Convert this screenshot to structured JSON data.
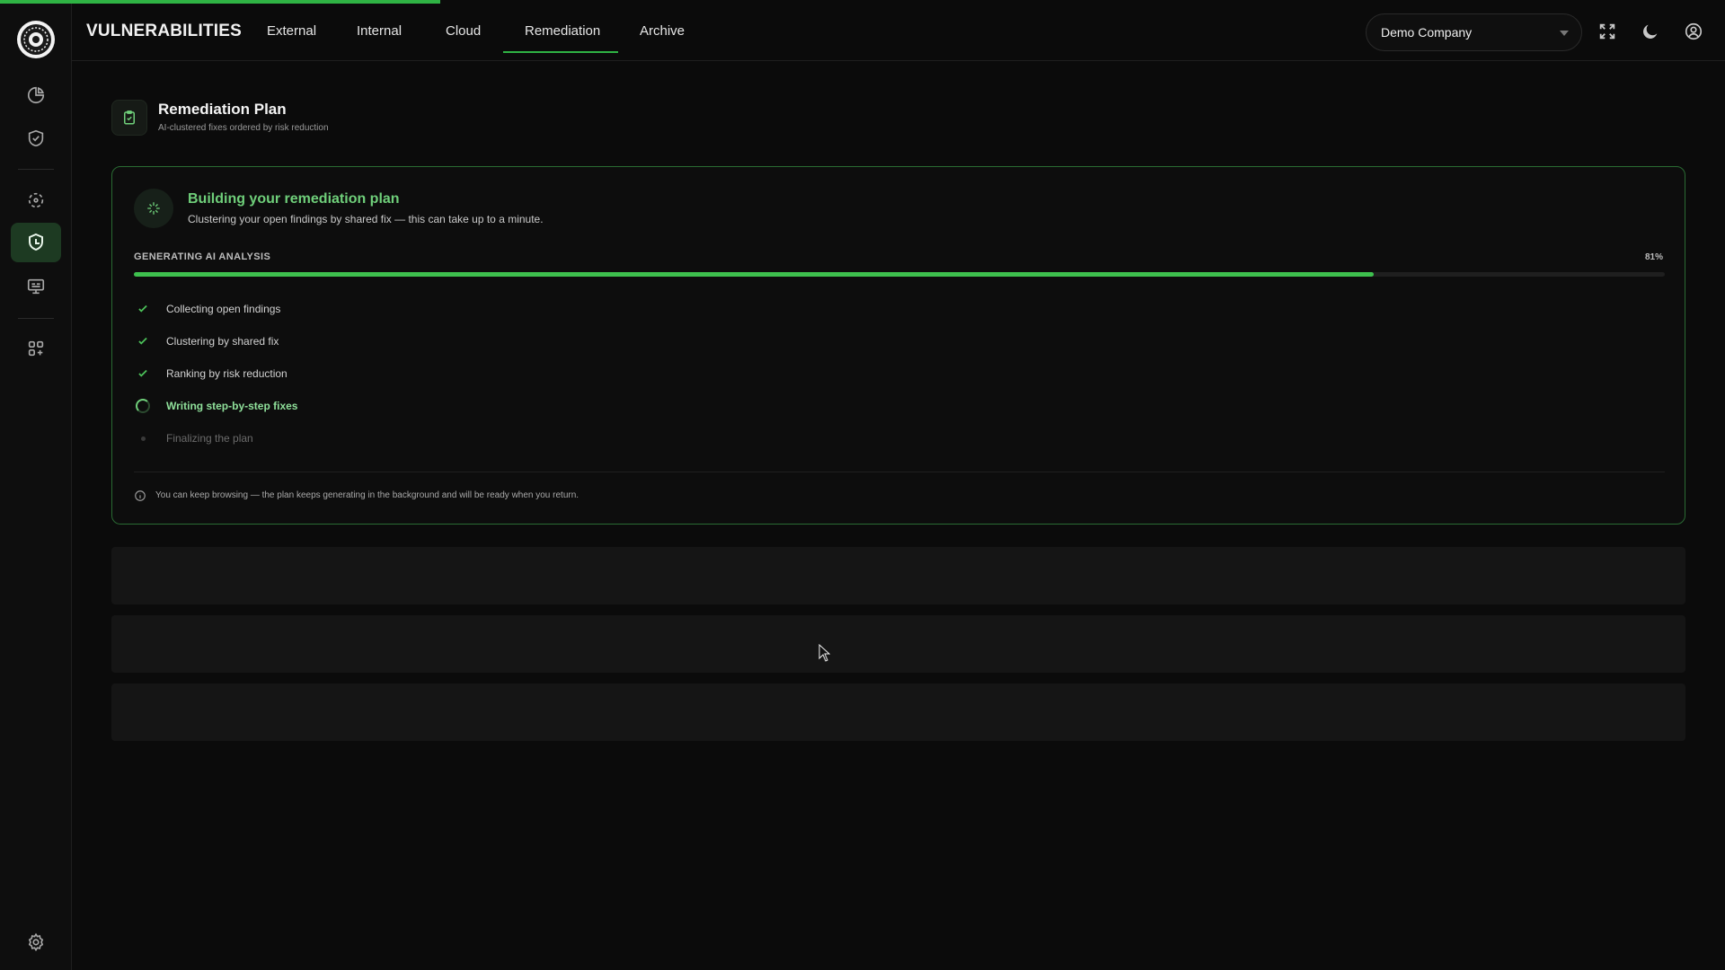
{
  "app": {
    "title": "VULNERABILITIES",
    "accent_color": "#2fb344",
    "top_progress_fraction": 0.255
  },
  "header": {
    "tabs": [
      {
        "label": "External",
        "active": false
      },
      {
        "label": "Internal",
        "active": false
      },
      {
        "label": "Cloud",
        "active": false
      },
      {
        "label": "Remediation",
        "active": true
      },
      {
        "label": "Archive",
        "active": false
      }
    ],
    "company_select": {
      "value": "Demo Company"
    },
    "icons": [
      "fullscreen-icon",
      "moon-icon",
      "user-circle-icon"
    ]
  },
  "sidebar": {
    "items": [
      {
        "name": "dashboard",
        "icon": "pie-chart-icon"
      },
      {
        "name": "vulnerabilities",
        "icon": "shield-check-icon"
      },
      {
        "name": "attack-surface",
        "icon": "target-scan-icon"
      },
      {
        "name": "remediation",
        "icon": "shield-hand-icon",
        "active": true
      },
      {
        "name": "monitor",
        "icon": "monitor-icon"
      },
      {
        "name": "apps",
        "icon": "apps-add-icon"
      }
    ],
    "footer_icon": "gear-icon"
  },
  "page": {
    "title": "Remediation Plan",
    "subtitle": "AI-clustered fixes ordered by risk reduction",
    "icon": "clipboard-check-icon"
  },
  "status_card": {
    "title": "Building your remediation plan",
    "subtitle": "Clustering your open findings by shared fix — this can take up to a minute.",
    "progress_label": "GENERATING AI ANALYSIS",
    "progress_percent_text": "81%",
    "progress_value": 0.81,
    "steps": [
      {
        "label": "Collecting open findings",
        "state": "done"
      },
      {
        "label": "Clustering by shared fix",
        "state": "done"
      },
      {
        "label": "Ranking by risk reduction",
        "state": "done"
      },
      {
        "label": "Writing step-by-step fixes",
        "state": "current"
      },
      {
        "label": "Finalizing the plan",
        "state": "pending"
      }
    ],
    "note": "You can keep browsing — the plan keeps generating in the background and will be ready when you return.",
    "icon": "sparkle-icon"
  }
}
